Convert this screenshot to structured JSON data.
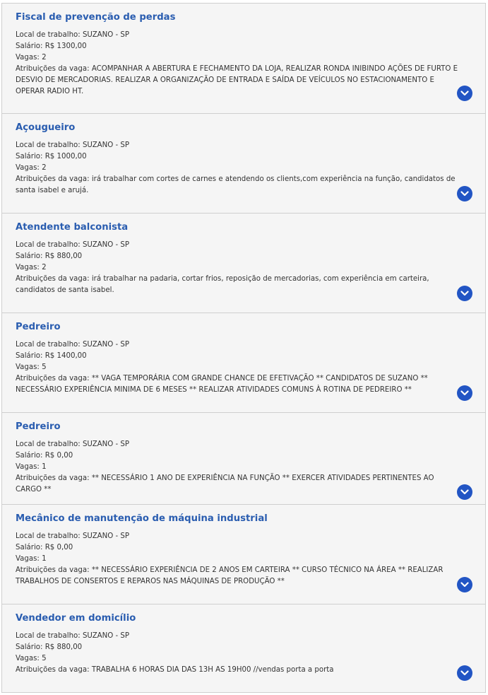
{
  "labels": {
    "local": "Local de trabalho:",
    "salario": "Salário:",
    "vagas": "Vagas:",
    "atribuicoes": "Atribuições da vaga:"
  },
  "accent_color": "#2a5db0",
  "expand_icon": "chevron-down-icon",
  "jobs": [
    {
      "title": "Fiscal de prevenção de perdas",
      "local": "SUZANO - SP",
      "salario": "R$ 1300,00",
      "vagas": "2",
      "atribuicoes": "ACOMPANHAR A ABERTURA E FECHAMENTO DA LOJA, REALIZAR RONDA INIBINDO AÇÕES DE FURTO E DESVIO DE MERCADORIAS. REALIZAR A ORGANIZAÇÃO DE ENTRADA E SAÍDA DE VEÍCULOS NO ESTACIONAMENTO E OPERAR RADIO HT."
    },
    {
      "title": "Açougueiro",
      "local": "SUZANO - SP",
      "salario": "R$ 1000,00",
      "vagas": "2",
      "atribuicoes": "irá trabalhar com cortes de carnes e atendendo os clients,com experiência na função, candidatos de santa isabel e arujá."
    },
    {
      "title": "Atendente balconista",
      "local": "SUZANO - SP",
      "salario": "R$ 880,00",
      "vagas": "2",
      "atribuicoes": "irá trabalhar na padaria, cortar frios, reposição de mercadorias, com experiência em carteira, candidatos de santa isabel."
    },
    {
      "title": "Pedreiro",
      "local": "SUZANO - SP",
      "salario": "R$ 1400,00",
      "vagas": "5",
      "atribuicoes": "** VAGA TEMPORÁRIA COM GRANDE CHANCE DE EFETIVAÇÃO ** CANDIDATOS DE SUZANO ** NECESSÁRIO EXPERIÊNCIA MINIMA DE 6 MESES ** REALIZAR ATIVIDADES COMUNS À ROTINA DE PEDREIRO **"
    },
    {
      "title": "Pedreiro",
      "local": "SUZANO - SP",
      "salario": "R$ 0,00",
      "vagas": "1",
      "atribuicoes": "** NECESSÁRIO 1 ANO DE EXPERIÊNCIA NA FUNÇÃO ** EXERCER ATIVIDADES PERTINENTES AO CARGO **"
    },
    {
      "title": "Mecânico de manutenção de máquina industrial",
      "local": "SUZANO - SP",
      "salario": "R$ 0,00",
      "vagas": "1",
      "atribuicoes": "** NECESSÁRIO EXPERIÊNCIA DE 2 ANOS EM CARTEIRA ** CURSO TÉCNICO NA ÁREA ** REALIZAR TRABALHOS DE CONSERTOS E REPAROS NAS MÁQUINAS DE PRODUÇÃO **"
    },
    {
      "title": "Vendedor em domicílio",
      "local": "SUZANO - SP",
      "salario": "R$ 880,00",
      "vagas": "5",
      "atribuicoes": "TRABALHA 6 HORAS DIA DAS 13H AS 19H00 //vendas porta a porta"
    }
  ]
}
